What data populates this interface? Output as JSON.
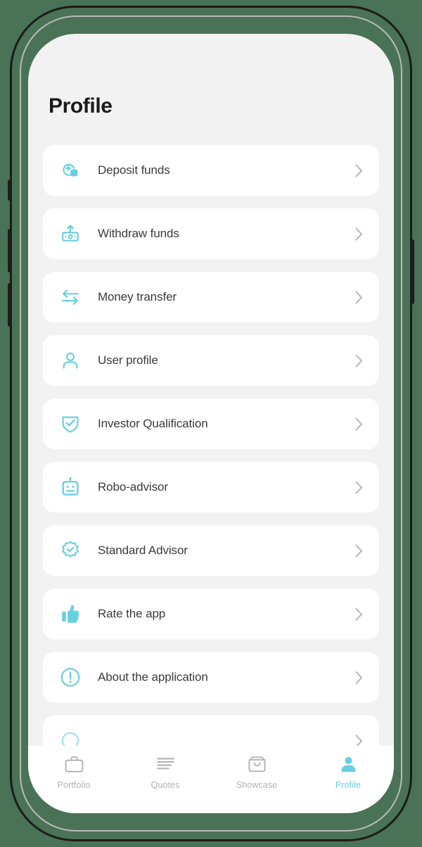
{
  "theme": {
    "background": "#4a7256",
    "screen_bg": "#f2f2f2",
    "card_bg": "#ffffff",
    "accent": "#69cfe0",
    "text_primary": "#1b1b1b",
    "text_row": "#3b3b3b",
    "text_muted": "#b2b2b2",
    "chevron": "#bdbdbd"
  },
  "header": {
    "title": "Profile"
  },
  "menu": {
    "items": [
      {
        "label": "Deposit funds",
        "icon": "deposit-funds-icon"
      },
      {
        "label": "Withdraw funds",
        "icon": "withdraw-funds-icon"
      },
      {
        "label": "Money transfer",
        "icon": "money-transfer-icon"
      },
      {
        "label": "User profile",
        "icon": "user-profile-icon"
      },
      {
        "label": "Investor Qualification",
        "icon": "shield-check-icon"
      },
      {
        "label": "Robo-advisor",
        "icon": "robot-icon"
      },
      {
        "label": "Standard Advisor",
        "icon": "verified-badge-icon"
      },
      {
        "label": "Rate the app",
        "icon": "thumbs-up-icon"
      },
      {
        "label": "About the application",
        "icon": "info-circle-icon"
      },
      {
        "label": "",
        "icon": "partial-row-icon"
      }
    ],
    "chevron_glyph": "›"
  },
  "tabbar": {
    "items": [
      {
        "label": "Portfolio",
        "icon": "briefcase-icon",
        "active": false
      },
      {
        "label": "Quotes",
        "icon": "list-lines-icon",
        "active": false
      },
      {
        "label": "Showcase",
        "icon": "shopping-bag-icon",
        "active": false
      },
      {
        "label": "Profile",
        "icon": "person-icon",
        "active": true
      }
    ]
  }
}
